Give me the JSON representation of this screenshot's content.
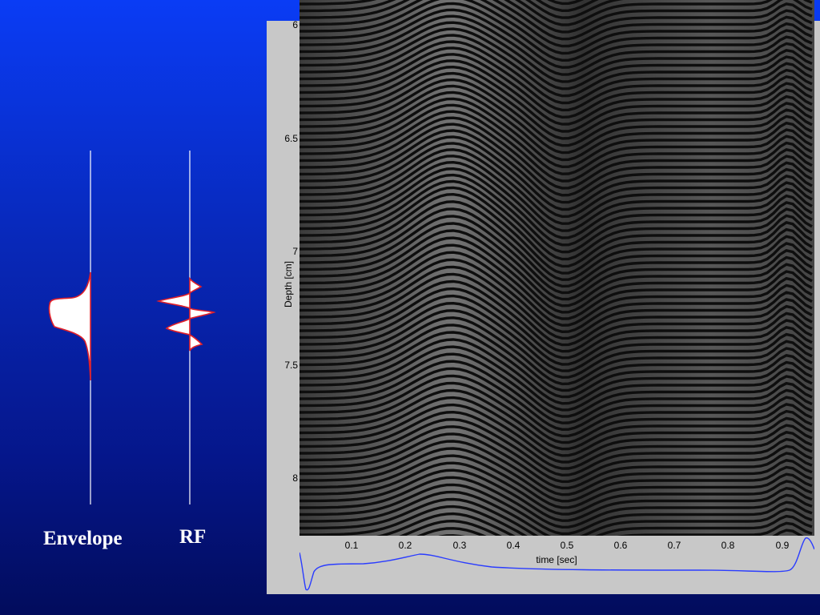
{
  "slide": {
    "envelope_label": "Envelope",
    "rf_label": "RF"
  },
  "figure": {
    "y_axis_label": "Depth [cm]",
    "x_axis_label": "time [sec]",
    "y_ticks": [
      "6",
      "6.5",
      "7",
      "7.5",
      "8"
    ],
    "x_ticks": [
      "0.1",
      "0.2",
      "0.3",
      "0.4",
      "0.5",
      "0.6",
      "0.7",
      "0.8",
      "0.9"
    ]
  },
  "colors": {
    "background_top": "#0a3cf5",
    "background_bottom": "#020c5c",
    "waveform_outline": "#e0202a",
    "trace_line": "#2a3cff"
  }
}
